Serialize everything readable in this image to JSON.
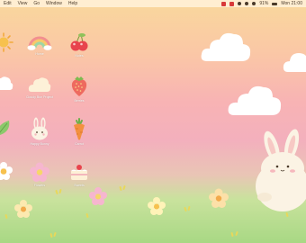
{
  "menubar": {
    "items": [
      "Edit",
      "View",
      "Go",
      "Window",
      "Help"
    ],
    "battery": "91%",
    "clock": "Mon 21:00"
  },
  "desktop": {
    "icons": [
      {
        "name": "sun",
        "label": ""
      },
      {
        "name": "rainbow",
        "label": "Home"
      },
      {
        "name": "cherry",
        "label": "Notes"
      },
      {
        "name": "cloud",
        "label": ""
      },
      {
        "name": "cloud-bun",
        "label": "Cloudy Bun Project"
      },
      {
        "name": "strawberry",
        "label": "Berries"
      },
      {
        "name": "leaf",
        "label": ""
      },
      {
        "name": "bunny",
        "label": "Happy Bunny"
      },
      {
        "name": "carrot",
        "label": "Carrot"
      },
      {
        "name": "flower-yellow",
        "label": ""
      },
      {
        "name": "flower-pink",
        "label": "Flowers"
      },
      {
        "name": "cake",
        "label": "Sweets"
      }
    ]
  },
  "colors": {
    "sky_top": "#f9d89c",
    "sky_mid": "#f8b3b4",
    "grass": "#a8d884",
    "cloud": "#ffffff",
    "bunny": "#fbf3e4"
  }
}
